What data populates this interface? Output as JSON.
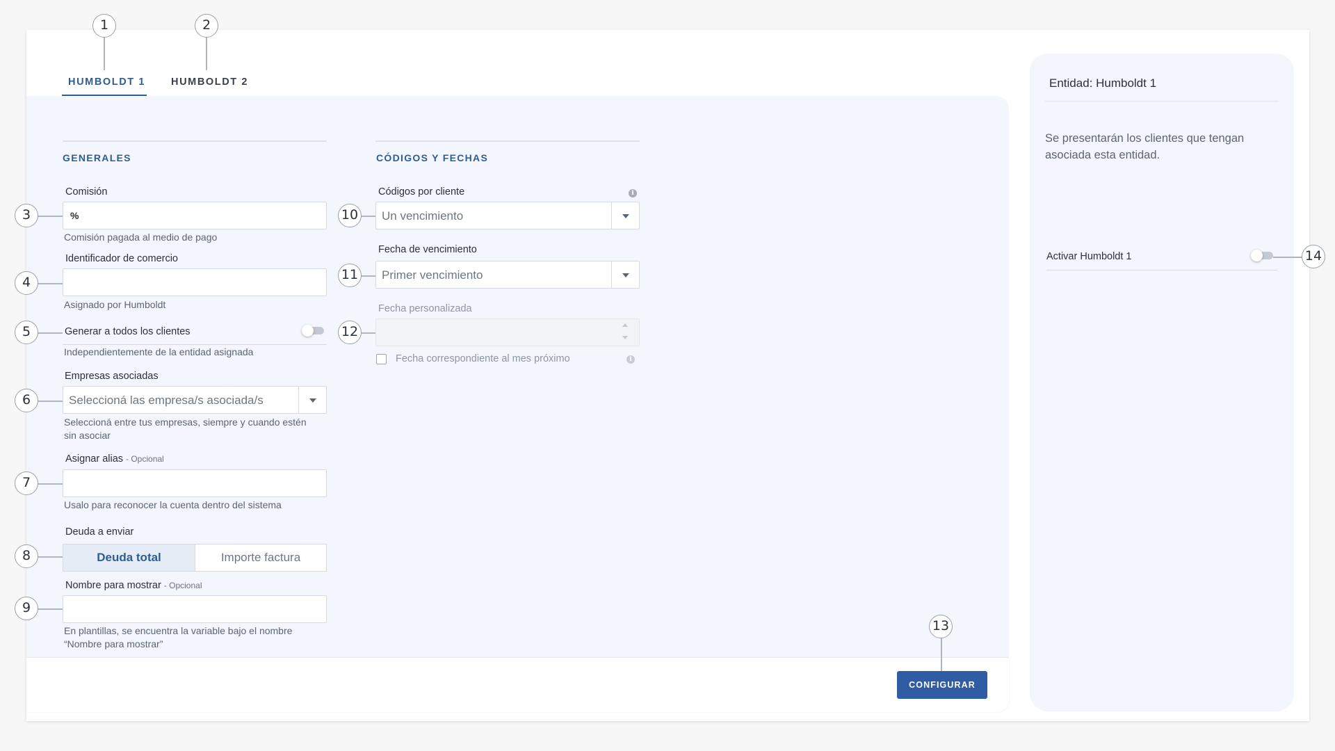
{
  "tabs": [
    {
      "label": "HUMBOLDT 1",
      "active": true
    },
    {
      "label": "HUMBOLDT 2",
      "active": false
    }
  ],
  "sections": {
    "generales": "GENERALES",
    "codigos": "CÓDIGOS Y FECHAS"
  },
  "fields": {
    "comision": {
      "label": "Comisión",
      "prefix": "%",
      "helper": "Comisión pagada al medio de pago"
    },
    "identificador": {
      "label": "Identificador de comercio",
      "helper": "Asignado por Humboldt"
    },
    "generar": {
      "label": "Generar a todos los clientes",
      "helper": "Independientemente de la entidad asignada",
      "enabled": false
    },
    "empresas": {
      "label": "Empresas asociadas",
      "placeholder": "Seleccioná las empresa/s asociada/s",
      "helper_line1": "Seleccioná entre tus empresas, siempre y cuando estén",
      "helper_line2": "sin asociar"
    },
    "alias": {
      "label": "Asignar alias",
      "optional": "- Opcional",
      "helper": "Usalo para reconocer la cuenta dentro del sistema"
    },
    "deuda": {
      "label": "Deuda a enviar",
      "options": [
        "Deuda total",
        "Importe factura"
      ],
      "selected": "Deuda total"
    },
    "nombre": {
      "label": "Nombre para mostrar",
      "optional": "- Opcional",
      "helper_line1": "En plantillas, se encuentra la variable bajo el nombre",
      "helper_line2": "“Nombre para mostrar”"
    },
    "codigos_cliente": {
      "label": "Códigos por cliente",
      "value": "Un vencimiento"
    },
    "fecha_venc": {
      "label": "Fecha de vencimiento",
      "value": "Primer vencimiento"
    },
    "fecha_pers": {
      "label": "Fecha personalizada",
      "value": ""
    },
    "mes_proximo": {
      "label": "Fecha correspondiente al mes próximo",
      "checked": false
    }
  },
  "actions": {
    "configurar": "CONFIGURAR"
  },
  "side": {
    "title": "Entidad: Humboldt 1",
    "description": "Se presentarán los clientes que tengan asociada esta entidad.",
    "toggle_label": "Activar Humboldt 1",
    "toggle_enabled": false
  },
  "icons": {
    "info": "info-icon",
    "caret": "chevron-down-icon"
  },
  "info_glyph": "i",
  "colors": {
    "accent": "#2f5c93",
    "button": "#2f5ca3",
    "panel": "#f3f6fc"
  },
  "callouts": [
    "1",
    "2",
    "3",
    "4",
    "5",
    "6",
    "7",
    "8",
    "9",
    "10",
    "11",
    "12",
    "13",
    "14"
  ]
}
